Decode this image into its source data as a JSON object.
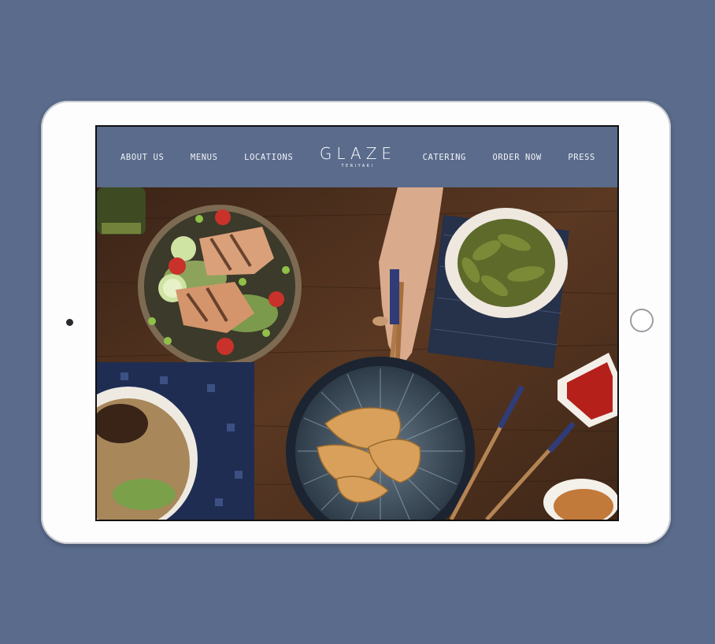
{
  "nav": {
    "items": [
      "ABOUT US",
      "MENUS",
      "LOCATIONS",
      "CATERING",
      "ORDER NOW",
      "PRESS"
    ]
  },
  "logo": {
    "main": "GLAZE",
    "sub": "TERIYAKI"
  },
  "colors": {
    "background": "#5a6b8c",
    "header": "#5a6b8c",
    "table_wood": "#4a2e1c"
  },
  "hero": {
    "image": "food-table-photo"
  }
}
